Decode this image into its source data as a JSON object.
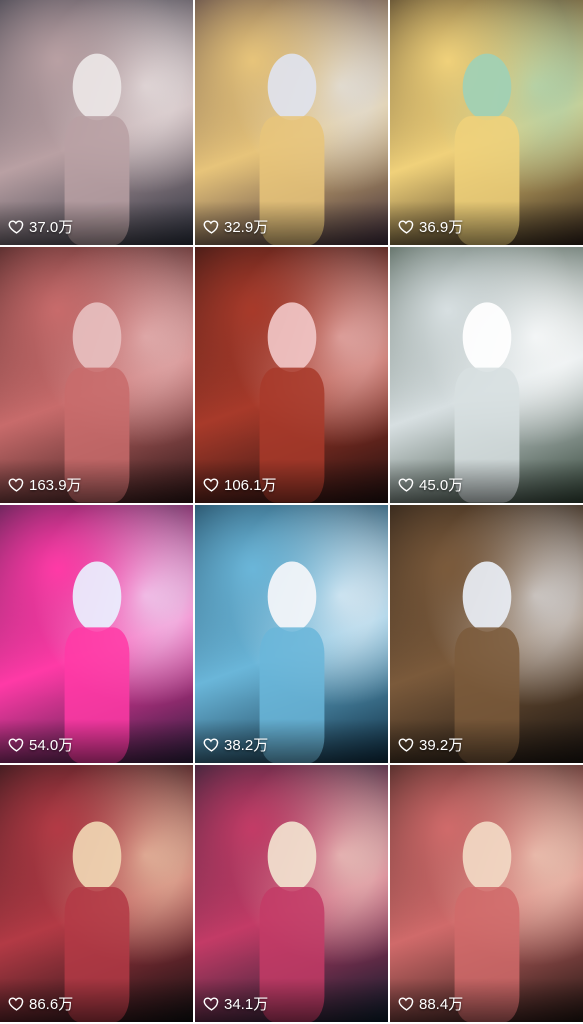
{
  "tiles": [
    {
      "likes": "37.0万",
      "colors": {
        "a": "#2a2f3c",
        "b": "#b9a0a3",
        "c": "#ece6e6"
      }
    },
    {
      "likes": "32.9万",
      "colors": {
        "a": "#3b2a3a",
        "b": "#e7c47a",
        "c": "#dfe3ee"
      }
    },
    {
      "likes": "36.9万",
      "colors": {
        "a": "#2d2018",
        "b": "#f0d17a",
        "c": "#9fd0b5"
      }
    },
    {
      "likes": "163.9万",
      "colors": {
        "a": "#2a1414",
        "b": "#c86b6b",
        "c": "#e7bfbf"
      }
    },
    {
      "likes": "106.1万",
      "colors": {
        "a": "#1f0f0f",
        "b": "#a83a2a",
        "c": "#f1c6c6"
      }
    },
    {
      "likes": "45.0万",
      "colors": {
        "a": "#304235",
        "b": "#d7dfe1",
        "c": "#ffffff"
      }
    },
    {
      "likes": "54.0万",
      "colors": {
        "a": "#2a1d3b",
        "b": "#ff3aa6",
        "c": "#eaf0ff"
      }
    },
    {
      "likes": "38.2万",
      "colors": {
        "a": "#0d2a3e",
        "b": "#6ab6d9",
        "c": "#f5f6fa"
      }
    },
    {
      "likes": "39.2万",
      "colors": {
        "a": "#1a1410",
        "b": "#7b5a3b",
        "c": "#e9eef5"
      }
    },
    {
      "likes": "86.6万",
      "colors": {
        "a": "#0f0f10",
        "b": "#b33a45",
        "c": "#f0d6b3"
      }
    },
    {
      "likes": "34.1万",
      "colors": {
        "a": "#0a1c2a",
        "b": "#c33b66",
        "c": "#f2e2cf"
      }
    },
    {
      "likes": "88.4万",
      "colors": {
        "a": "#1f1410",
        "b": "#d06a6a",
        "c": "#f2d9c4"
      }
    }
  ],
  "icons": {
    "like": "heart-outline-icon"
  }
}
